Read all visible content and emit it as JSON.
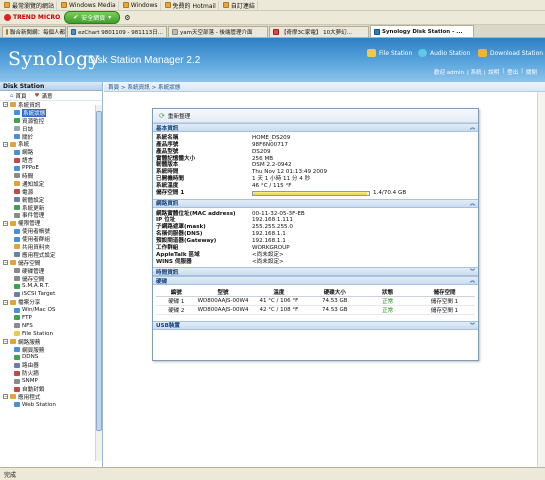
{
  "browser": {
    "bookmarks": [
      "最常瀏覽的網站",
      "Windows Media",
      "Windows",
      "免費的 Hotmail",
      "自訂連結"
    ],
    "toolbar": {
      "trend_label": "TREND MICRO",
      "safe_label": "安全網頁"
    },
    "tabs": [
      "聯合新聞網：每個人都可...",
      "ezChart 9801109 - 981113日...",
      "yam天空部落 - 後端管理介面",
      "【奇摩3C家電】 10大夢幻...",
      "Synology Disk Station - ..."
    ],
    "status": "完成"
  },
  "header": {
    "logo": "Synology",
    "title": "Disk Station Manager 2.2",
    "quick": [
      "File Station",
      "Audio Station",
      "Download Station"
    ],
    "user_links": [
      "歡迎 admin",
      "| 系統 |",
      "說明",
      "|",
      "登出",
      "|",
      "關閉"
    ],
    "colors": {
      "header_top": "#2d7fc4",
      "header_bottom": "#8ec4ea",
      "file_station": "#f2c94c",
      "audio_station": "#5fc7e8",
      "download_station": "#f0b338"
    }
  },
  "sidebar": {
    "title": "Disk Station",
    "tools": [
      "首頁",
      "滿意"
    ],
    "tree": [
      {
        "label": "系統資訊",
        "level": 0,
        "exp": true,
        "color": "#e0a43a"
      },
      {
        "label": "系統狀態",
        "level": 1,
        "sel": true,
        "color": "#4a90d9"
      },
      {
        "label": "資源監控",
        "level": 1,
        "color": "#3fa34d"
      },
      {
        "label": "日誌",
        "level": 1,
        "color": "#9aa4b0"
      },
      {
        "label": "關於",
        "level": 1,
        "color": "#4a90d9"
      },
      {
        "label": "系統",
        "level": 0,
        "exp": true,
        "color": "#e0a43a"
      },
      {
        "label": "網路",
        "level": 1,
        "color": "#4a90d9"
      },
      {
        "label": "語言",
        "level": 1,
        "color": "#c04a4a"
      },
      {
        "label": "PPPoE",
        "level": 1,
        "color": "#4a90d9"
      },
      {
        "label": "時間",
        "level": 1,
        "color": "#8a8a8a"
      },
      {
        "label": "通知設定",
        "level": 1,
        "color": "#e0a43a"
      },
      {
        "label": "電源",
        "level": 1,
        "color": "#c04a4a"
      },
      {
        "label": "韌體設定",
        "level": 1,
        "color": "#6a7fa8"
      },
      {
        "label": "系統更新",
        "level": 1,
        "color": "#3fa34d"
      },
      {
        "label": "事件管理",
        "level": 1,
        "color": "#8a8a8a"
      },
      {
        "label": "權限管理",
        "level": 0,
        "exp": true,
        "color": "#e0a43a"
      },
      {
        "label": "使用者帳號",
        "level": 1,
        "color": "#4a90d9"
      },
      {
        "label": "使用者群組",
        "level": 1,
        "color": "#4a90d9"
      },
      {
        "label": "共用資料夾",
        "level": 1,
        "color": "#e0a43a"
      },
      {
        "label": "應用程式設定",
        "level": 1,
        "color": "#6a7fa8"
      },
      {
        "label": "儲存空間",
        "level": 0,
        "exp": true,
        "color": "#e0a43a"
      },
      {
        "label": "硬碟管理",
        "level": 1,
        "color": "#8a8a8a"
      },
      {
        "label": "儲存空間",
        "level": 1,
        "color": "#8a8a8a"
      },
      {
        "label": "S.M.A.R.T.",
        "level": 1,
        "color": "#3fa34d"
      },
      {
        "label": "iSCSI Target",
        "level": 1,
        "color": "#6a7fa8"
      },
      {
        "label": "檔案分享",
        "level": 0,
        "exp": true,
        "color": "#e0a43a"
      },
      {
        "label": "Win/Mac OS",
        "level": 1,
        "color": "#4a90d9"
      },
      {
        "label": "FTP",
        "level": 1,
        "color": "#3fa34d"
      },
      {
        "label": "NFS",
        "level": 1,
        "color": "#8a8a8a"
      },
      {
        "label": "File Station",
        "level": 1,
        "color": "#f2c94c"
      },
      {
        "label": "網路服務",
        "level": 0,
        "exp": true,
        "color": "#e0a43a"
      },
      {
        "label": "網頁服務",
        "level": 1,
        "color": "#4a90d9"
      },
      {
        "label": "DDNS",
        "level": 1,
        "color": "#3fa34d"
      },
      {
        "label": "路由器",
        "level": 1,
        "color": "#6a7fa8"
      },
      {
        "label": "防火牆",
        "level": 1,
        "color": "#c04a4a"
      },
      {
        "label": "SNMP",
        "level": 1,
        "color": "#8a8a8a"
      },
      {
        "label": "自動封鎖",
        "level": 1,
        "color": "#c04a4a"
      },
      {
        "label": "應用程式",
        "level": 0,
        "exp": true,
        "color": "#e0a43a"
      },
      {
        "label": "Web Station",
        "level": 1,
        "color": "#4a90d9"
      }
    ]
  },
  "main": {
    "breadcrumb": "首頁 > 系統資訊 > 系統狀態",
    "window_tool": "重新整理",
    "sections": {
      "basic": "基本資訊",
      "network": "網路資訊",
      "time": "時間資訊",
      "disk": "硬碟",
      "usb": "USB裝置"
    },
    "basic": [
      {
        "k": "系統名稱",
        "v": "HOME_DS209"
      },
      {
        "k": "產品序號",
        "v": "98F6N00717"
      },
      {
        "k": "產品型號",
        "v": "DS209"
      },
      {
        "k": "實體記憶體大小",
        "v": "256 MB"
      },
      {
        "k": "韌體版本",
        "v": "DSM 2.2-0942"
      },
      {
        "k": "系統時間",
        "v": "Thu Nov 12 01:13:49 2009"
      },
      {
        "k": "已開機時間",
        "v": "1 天 1 小時 11 分 4 秒"
      },
      {
        "k": "系統溫度",
        "v": "46 °C / 115 °F"
      }
    ],
    "storage": {
      "k": "儲存空間 1",
      "v": "1.4/70.4 GB",
      "fraction": 0.98
    },
    "network": [
      {
        "k": "網路實體位址(MAC address)",
        "v": "00-11-32-05-3F-EB"
      },
      {
        "k": "IP 位址",
        "v": "192.168.1.111"
      },
      {
        "k": "子網路遮罩(mask)",
        "v": "255.255.255.0"
      },
      {
        "k": "名稱伺服器(DNS)",
        "v": "192.168.1.1"
      },
      {
        "k": "預設閘道器(Gateway)",
        "v": "192.168.1.1"
      },
      {
        "k": "工作群組",
        "v": "WORKGROUP"
      },
      {
        "k": "AppleTalk 區域",
        "v": "<尚未設定>"
      },
      {
        "k": "WINS 伺服器",
        "v": "<尚未設定>"
      }
    ],
    "disk_headers": [
      "編號",
      "型號",
      "溫度",
      "硬碟大小",
      "狀態",
      "儲存空間"
    ],
    "disks": [
      [
        "硬碟 1",
        "WD800AAJS-00W4",
        "41 °C / 106 °F",
        "74.53 GB",
        "正常",
        "儲存空間 1"
      ],
      [
        "硬碟 2",
        "WD800AAJS-00W4",
        "42 °C / 108 °F",
        "74.53 GB",
        "正常",
        "儲存空間 1"
      ]
    ]
  }
}
